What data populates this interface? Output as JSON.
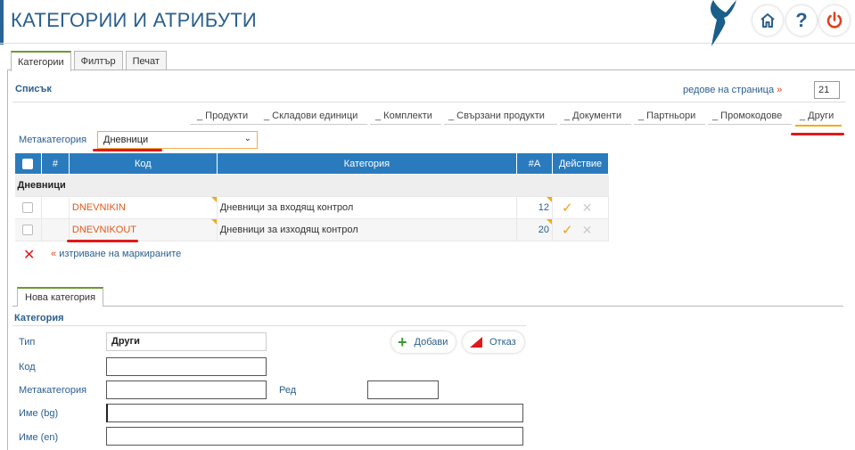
{
  "header": {
    "title": "КАТЕГОРИИ И АТРИБУТИ",
    "help_label": "?"
  },
  "tabs": [
    "Категории",
    "Филтър",
    "Печат"
  ],
  "list": {
    "title": "Списък",
    "rows_per_page_label": "редове на страница",
    "rows_per_page_arrow": "»",
    "rows_per_page_value": "21"
  },
  "subnav": [
    "_ Продукти",
    "_ Складови единици",
    "_ Комплекти",
    "_ Свързани продукти",
    "_ Документи",
    "_ Партньори",
    "_ Промокодове",
    "_ Други"
  ],
  "meta": {
    "label": "Метакатегория",
    "selected": "Дневници"
  },
  "table": {
    "headers": [
      "#",
      "Код",
      "Категория",
      "#A",
      "Действие"
    ],
    "group": "Дневници",
    "rows": [
      {
        "code": "DNEVNIKIN",
        "category": "Дневници за входящ контрол",
        "count": "12"
      },
      {
        "code": "DNEVNIKOUT",
        "category": "Дневници за изходящ контрол",
        "count": "20"
      }
    ]
  },
  "delete": {
    "arrow": "«",
    "label": "изтриване на маркираните"
  },
  "form": {
    "tab": "Нова категория",
    "title": "Категория",
    "type_label": "Тип",
    "type_value": "Други",
    "code_label": "Код",
    "meta_label": "Метакатегория",
    "order_label": "Ред",
    "name_bg_label": "Име (bg)",
    "name_en_label": "Име (en)",
    "add_label": "Добави",
    "cancel_label": "Отказ"
  },
  "colors": {
    "brand_blue": "#2a5f8f",
    "table_header": "#2a7bbd",
    "accent_orange": "#f0ad1a",
    "annotation_red": "#e0191a"
  }
}
